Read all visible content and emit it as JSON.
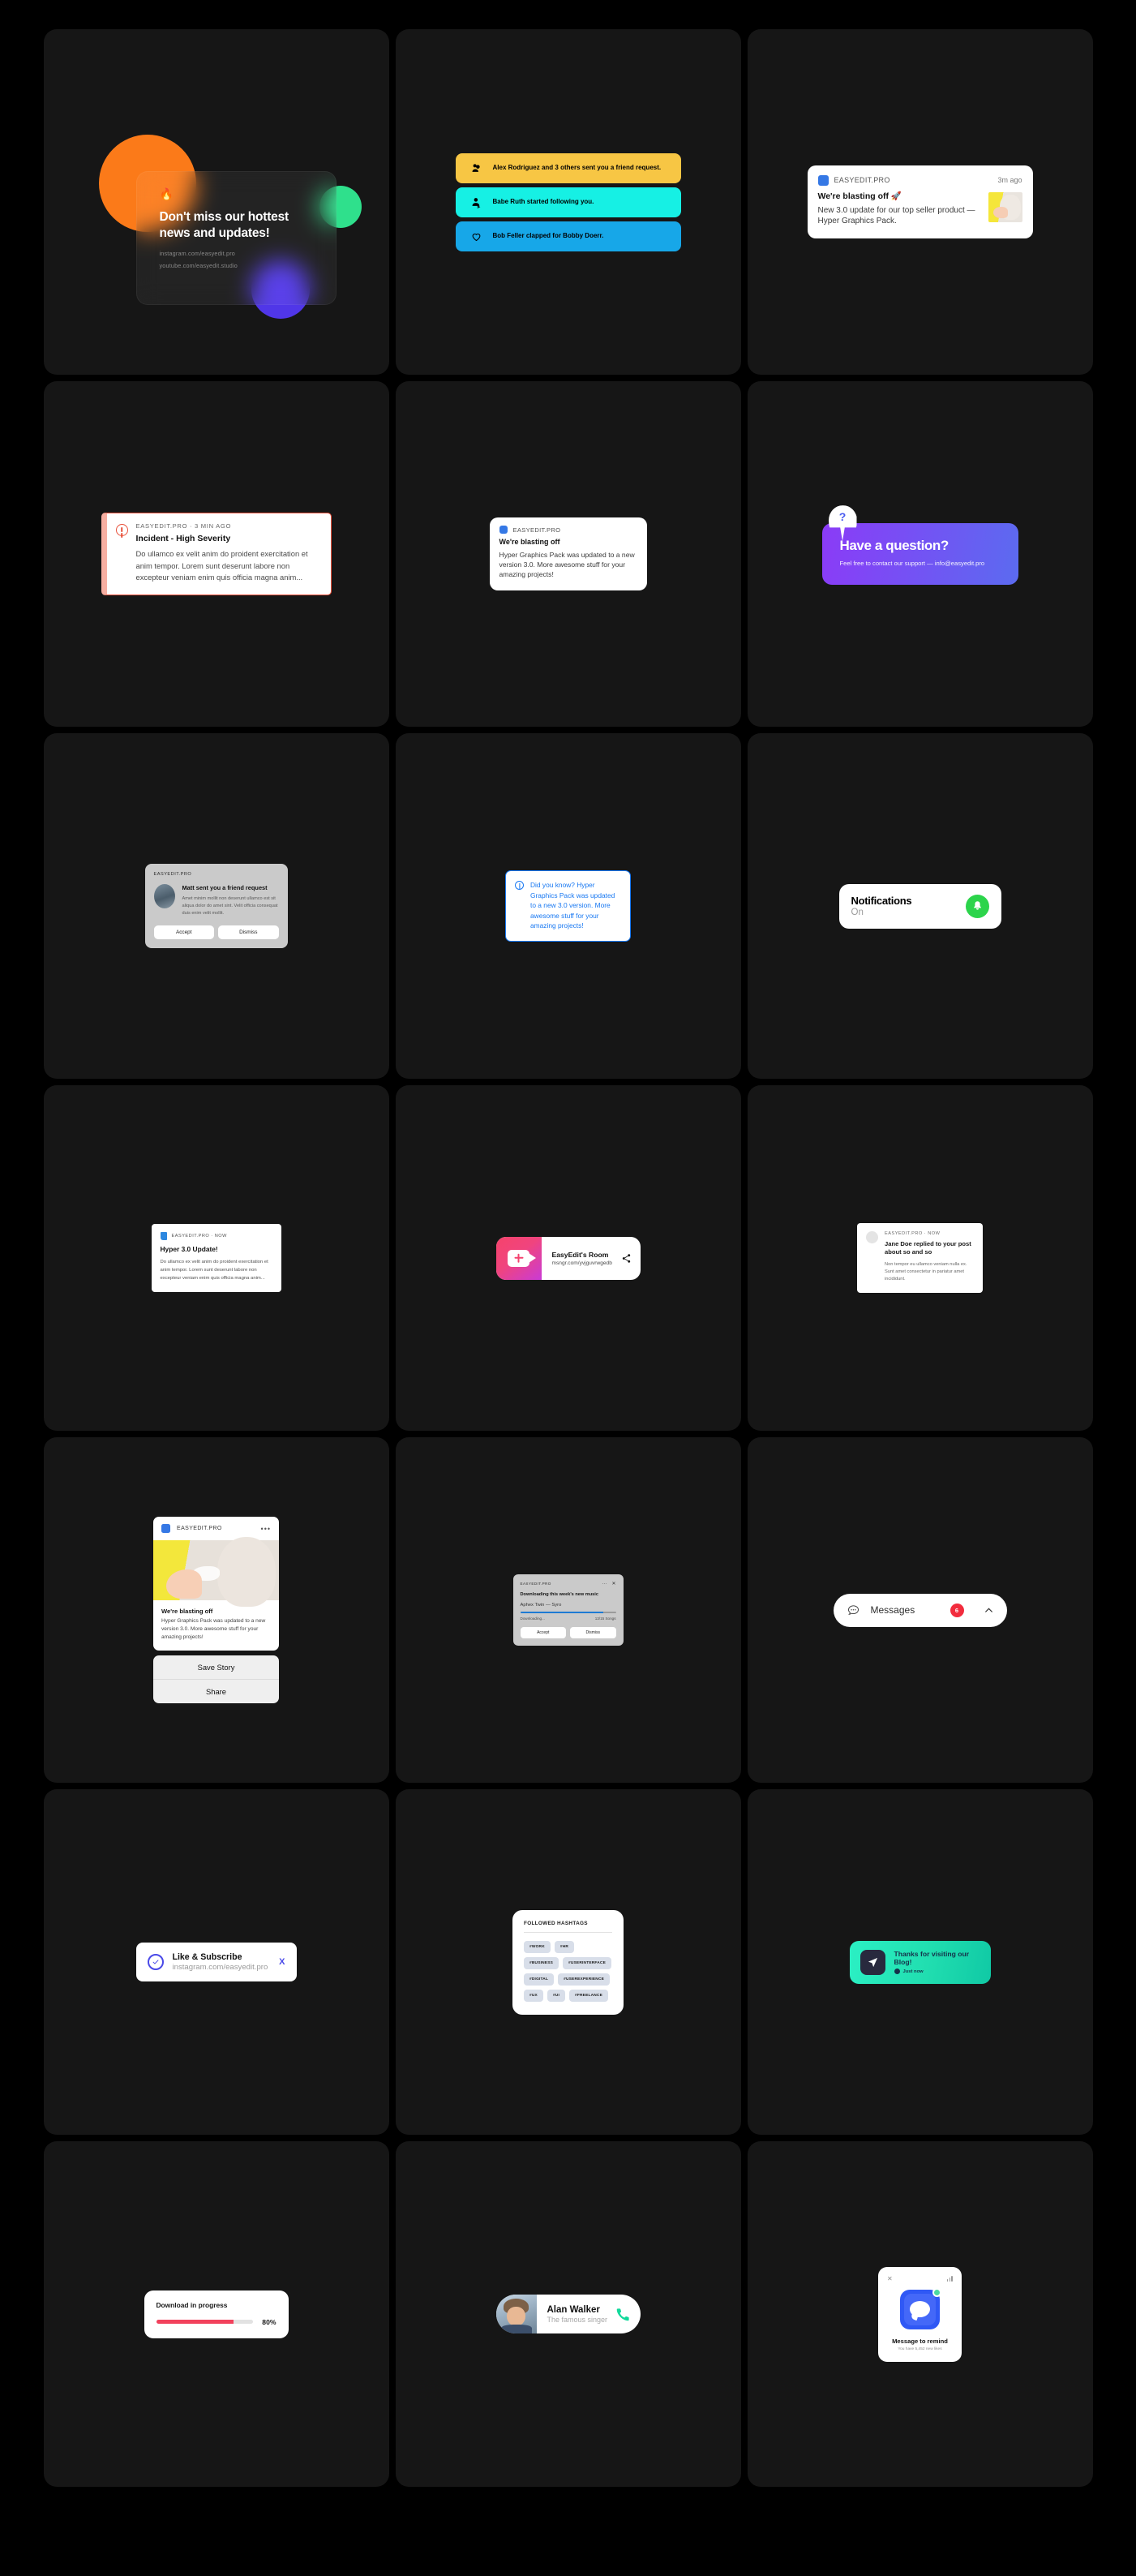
{
  "brand": "EASYEDIT.PRO",
  "colors": {
    "page_bg": "#000000",
    "cell_bg": "#161616",
    "blue": "#3578E5",
    "yellow": "#F7C644",
    "cyan": "#16F0E4",
    "light_blue": "#17A7E8",
    "red": "#E8503A",
    "green": "#2CD44B",
    "purple": "#8B3BF7",
    "teal": "#2BF0C4",
    "pink_red": "#F2415C"
  },
  "cards": {
    "glass": {
      "icon": "fire-icon",
      "title": "Don't miss our hottest news and updates!",
      "link1": "instagram.com/easyedit.pro",
      "link2": "youtube.com/easyedit.studio"
    },
    "action_rows": [
      {
        "icon": "friends-icon",
        "text": "Alex Rodriguez and 3 others sent you a friend request."
      },
      {
        "icon": "follower-icon",
        "text": "Babe Ruth started following you."
      },
      {
        "icon": "heart-icon",
        "text": "Bob Feller clapped for Bobby Doerr."
      }
    ],
    "blasting_rich": {
      "brand": "EASYEDIT.PRO",
      "time": "3m ago",
      "title": "We're blasting off 🚀",
      "body": "New 3.0 update for our top seller product — Hyper Graphics Pack."
    },
    "incident": {
      "meta": "EASYEDIT.PRO  ·  3 MIN AGO",
      "title": "Incident - High Severity",
      "body": "Do ullamco ex velit anim do proident exercitation et anim tempor. Lorem sunt deserunt labore non excepteur veniam enim quis officia magna anim..."
    },
    "blasting_plain": {
      "brand": "EASYEDIT.PRO",
      "title": "We're blasting off",
      "body": "Hyper Graphics Pack was updated to a new version 3.0. More awesome stuff for your amazing projects!"
    },
    "question": {
      "pin": "?",
      "title": "Have a question?",
      "body": "Feel free to contact our support — info@easyedit.pro"
    },
    "friend_request": {
      "brand": "EASYEDIT.PRO",
      "title": "Matt sent you a friend request",
      "body": "Amet minim mollit non deserunt ullamco est sit aliqua dolor do amet sint. Velit officia consequat duis enim velit mollit.",
      "accept": "Accept",
      "dismiss": "Dismiss"
    },
    "did_you_know": {
      "text": "Did you know? Hyper Graphics Pack was updated to a new 3.0 version. More awesome stuff for your amazing projects!"
    },
    "notifications": {
      "title": "Notifications",
      "status": "On",
      "icon": "bell-icon"
    },
    "hyper_update": {
      "meta": "EASYEDIT.PRO  ·  NOW",
      "title": "Hyper 3.0 Update!",
      "body": "Do ullamco ex velit anim do proident exercitation et anim tempor. Lorem sunt deserunt labore non excepteur veniam enim quis officia magna anim..."
    },
    "room": {
      "title": "EasyEdit's Room",
      "url": "msngr.com/yvjguvrwgedb",
      "share_icon": "share-icon"
    },
    "jane_doe": {
      "meta": "EASYEDIT.PRO  ·  NOW",
      "title": "Jane Doe replied to your post about so and so",
      "body": "Non tempor eu ullamco veniam nulla ex. Sunt amet consectetur in pariatur amet incididunt."
    },
    "story": {
      "brand": "EASYEDIT.PRO",
      "menu": "•••",
      "title": "We're blasting off",
      "body": "Hyper Graphics Pack was updated to a new version 3.0. More awesome stuff for your amazing projects!",
      "save": "Save Story",
      "share": "Share"
    },
    "music_download": {
      "brand": "EASYEDIT.PRO",
      "title": "Downloading this week's new music",
      "track": "Aphex Twin — Syro",
      "status": "Downloading...",
      "count": "13/15 Songs",
      "progress": 87,
      "accept": "Accept",
      "dismiss": "Dismiss"
    },
    "messages": {
      "label": "Messages",
      "badge": "6",
      "icon": "chat-bubble-icon",
      "chevron": "chevron-up-icon"
    },
    "like_subscribe": {
      "title": "Like & Subscribe",
      "url": "instagram.com/easyedit.pro",
      "close": "X"
    },
    "hashtags": {
      "header": "FOLLOWED HASHTAGS",
      "tags": [
        "#WORK",
        "#HR",
        "#BUSINESS",
        "#USERINTERFACE",
        "#DIGITAL",
        "#USEREXPERIENCE",
        "#UX",
        "#UI",
        "#FREELANCE"
      ]
    },
    "thanks_blog": {
      "title": "Thanks for visiting our Blog!",
      "time": "Just now",
      "icon": "send-icon"
    },
    "download_progress": {
      "title": "Download in progress",
      "percent": "80%",
      "value": 80
    },
    "alan_walker": {
      "name": "Alan Walker",
      "role": "The famous singer",
      "icon": "phone-icon"
    },
    "remind": {
      "close": "✕",
      "title": "Message to remind",
      "body": "You have 5,452 new likes"
    }
  }
}
